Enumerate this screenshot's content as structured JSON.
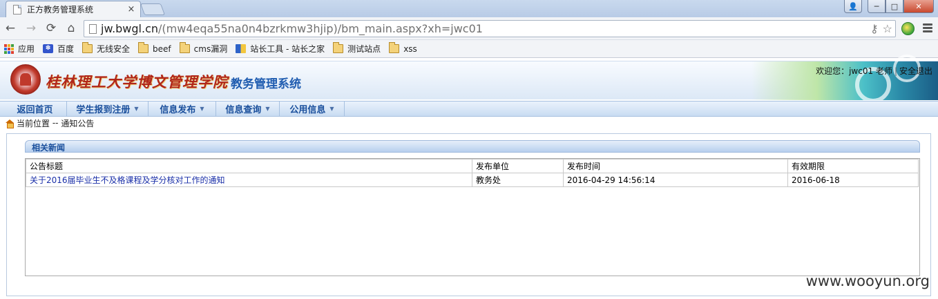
{
  "browser": {
    "tab_title": "正方教务管理系统",
    "tab_close": "×",
    "url_host": "jw.bwgl.cn",
    "url_path": "/(mw4eqa55na0n4bzrkmw3hjip)/bm_main.aspx?xh=jwc01",
    "nav": {
      "back": "←",
      "forward": "→",
      "reload": "⟳",
      "home": "⌂"
    },
    "omni_icons": {
      "key": "⚷",
      "star": "☆"
    },
    "window": {
      "user": "👤",
      "minimize": "─",
      "maximize": "□",
      "close": "✕"
    },
    "bookmarks": [
      {
        "label": "应用",
        "icon": "apps-grid-icon"
      },
      {
        "label": "百度",
        "icon": "baidu-paw-icon"
      },
      {
        "label": "无线安全",
        "icon": "folder-icon"
      },
      {
        "label": "beef",
        "icon": "folder-icon"
      },
      {
        "label": "cms漏洞",
        "icon": "folder-icon"
      },
      {
        "label": "站长工具 - 站长之家",
        "icon": "chinaz-icon"
      },
      {
        "label": "测试站点",
        "icon": "folder-icon"
      },
      {
        "label": "xss",
        "icon": "folder-icon"
      }
    ]
  },
  "header": {
    "school_name": "桂林理工大学博文管理学院",
    "system_name": "教务管理系统",
    "welcome_prefix": "欢迎您：",
    "user": "jwc01 老师",
    "logout": "安全退出",
    "separator": "|"
  },
  "menu": [
    {
      "label": "返回首页",
      "dropdown": false
    },
    {
      "label": "学生报到注册",
      "dropdown": true
    },
    {
      "label": "信息发布",
      "dropdown": true
    },
    {
      "label": "信息查询",
      "dropdown": true
    },
    {
      "label": "公用信息",
      "dropdown": true
    }
  ],
  "breadcrumb": {
    "prefix": "当前位置",
    "sep": " -- ",
    "current": "通知公告"
  },
  "panel": {
    "title": "相关新闻",
    "columns": [
      "公告标题",
      "发布单位",
      "发布时间",
      "有效期限"
    ],
    "rows": [
      {
        "title": "关于2016届毕业生不及格课程及学分核对工作的通知",
        "unit": "教务处",
        "published": "2016-04-29 14:56:14",
        "expires": "2016-06-18"
      }
    ]
  },
  "watermark": "www.wooyun.org",
  "colors": {
    "accent": "#1a4f9c",
    "link": "#1a2fa8",
    "school_red": "#b0261a"
  }
}
